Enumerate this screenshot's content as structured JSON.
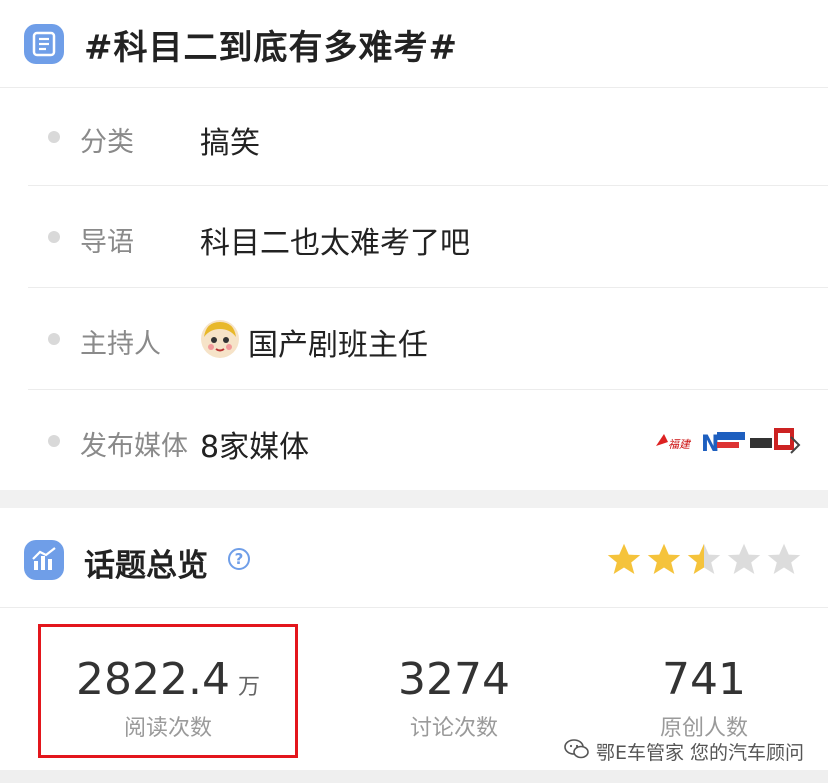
{
  "header": {
    "title": "#科目二到底有多难考#",
    "icon": "list-icon"
  },
  "rows": [
    {
      "label": "分类",
      "value": "搞笑"
    },
    {
      "label": "导语",
      "value": "科目二也太难考了吧"
    },
    {
      "label": "主持人",
      "value": "国产剧班主任",
      "avatar": "cartoon-avatar"
    },
    {
      "label": "发布媒体",
      "value": "8家媒体",
      "logos": [
        "media-logo-1",
        "media-logo-2",
        "media-logo-3"
      ]
    }
  ],
  "overview": {
    "title": "话题总览",
    "help_icon": "question-icon",
    "rating": {
      "score": 2.5,
      "max": 5
    },
    "star_color": "#f5c33b",
    "star_empty_color": "#dcdcdc"
  },
  "stats": [
    {
      "value": "2822.4",
      "unit": "万",
      "label": "阅读次数"
    },
    {
      "value": "3274",
      "label": "讨论次数"
    },
    {
      "value": "741",
      "label": "原创人数"
    }
  ],
  "watermark": {
    "text": "鄂E车管家 您的汽车顾问",
    "icon": "wechat-icon"
  },
  "colors": {
    "accent": "#6f9ee8",
    "highlight": "#e3161c"
  }
}
